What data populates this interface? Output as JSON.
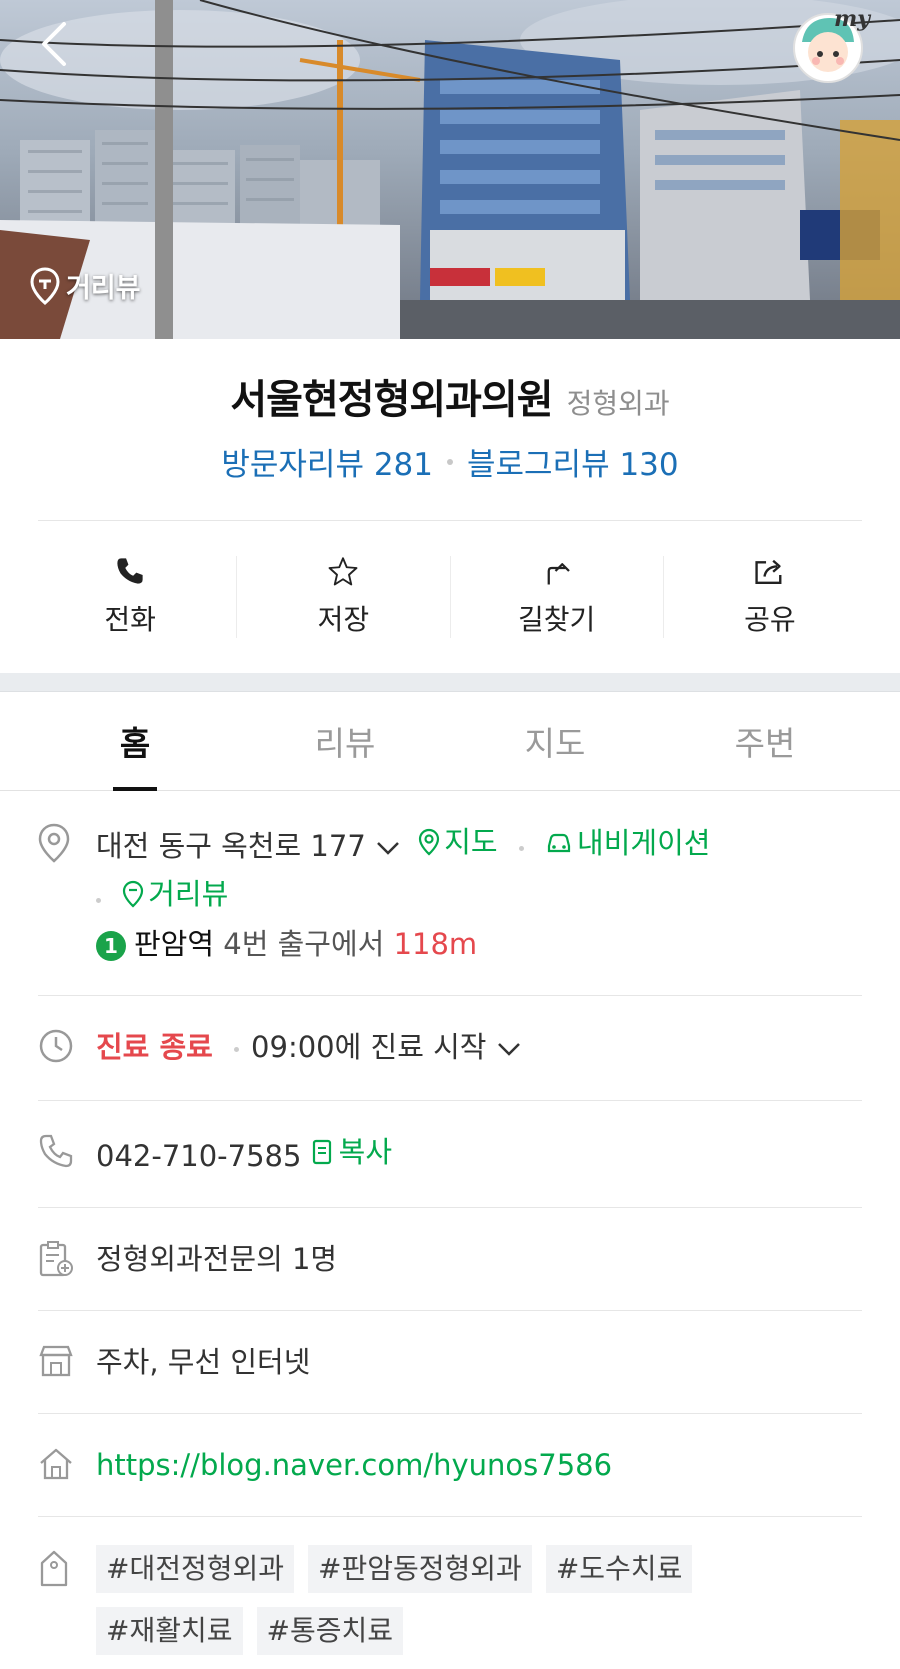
{
  "hero": {
    "street_view_label": "거리뷰",
    "my_label": "my"
  },
  "place": {
    "name": "서울현정형외과의원",
    "category": "정형외과",
    "visitor_review": "방문자리뷰 281",
    "blog_review": "블로그리뷰 130"
  },
  "actions": [
    {
      "label": "전화",
      "icon": "phone-icon"
    },
    {
      "label": "저장",
      "icon": "star-icon"
    },
    {
      "label": "길찾기",
      "icon": "directions-icon"
    },
    {
      "label": "공유",
      "icon": "share-icon"
    }
  ],
  "tabs": [
    "홈",
    "리뷰",
    "지도",
    "주변"
  ],
  "address": {
    "text": "대전 동구 옥천로 177",
    "map_link": "지도",
    "navigation_link": "내비게이션",
    "street_view_link": "거리뷰",
    "subway_line": "1",
    "station": "판암역",
    "exit_text": "4번 출구에서",
    "distance": "118m"
  },
  "hours": {
    "status": "진료 종료",
    "next": "09:00에 진료 시작"
  },
  "phone": {
    "number": "042-710-7585",
    "copy_label": "복사"
  },
  "doctors": "정형외과전문의 1명",
  "facilities": "주차, 무선 인터넷",
  "website": "https://blog.naver.com/hyunos7586",
  "tags": [
    "#대전정형외과",
    "#판암동정형외과",
    "#도수치료",
    "#재활치료",
    "#통증치료"
  ],
  "colors": {
    "link_blue": "#1b6fb6",
    "green": "#03a94d",
    "red": "#e5484d"
  }
}
